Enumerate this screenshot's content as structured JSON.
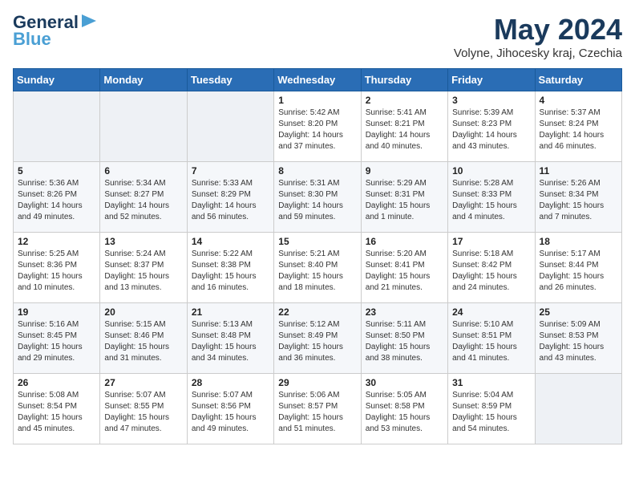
{
  "header": {
    "logo_line1": "General",
    "logo_line2": "Blue",
    "month_year": "May 2024",
    "location": "Volyne, Jihocesky kraj, Czechia"
  },
  "days_of_week": [
    "Sunday",
    "Monday",
    "Tuesday",
    "Wednesday",
    "Thursday",
    "Friday",
    "Saturday"
  ],
  "weeks": [
    [
      {
        "day": "",
        "info": ""
      },
      {
        "day": "",
        "info": ""
      },
      {
        "day": "",
        "info": ""
      },
      {
        "day": "1",
        "info": "Sunrise: 5:42 AM\nSunset: 8:20 PM\nDaylight: 14 hours\nand 37 minutes."
      },
      {
        "day": "2",
        "info": "Sunrise: 5:41 AM\nSunset: 8:21 PM\nDaylight: 14 hours\nand 40 minutes."
      },
      {
        "day": "3",
        "info": "Sunrise: 5:39 AM\nSunset: 8:23 PM\nDaylight: 14 hours\nand 43 minutes."
      },
      {
        "day": "4",
        "info": "Sunrise: 5:37 AM\nSunset: 8:24 PM\nDaylight: 14 hours\nand 46 minutes."
      }
    ],
    [
      {
        "day": "5",
        "info": "Sunrise: 5:36 AM\nSunset: 8:26 PM\nDaylight: 14 hours\nand 49 minutes."
      },
      {
        "day": "6",
        "info": "Sunrise: 5:34 AM\nSunset: 8:27 PM\nDaylight: 14 hours\nand 52 minutes."
      },
      {
        "day": "7",
        "info": "Sunrise: 5:33 AM\nSunset: 8:29 PM\nDaylight: 14 hours\nand 56 minutes."
      },
      {
        "day": "8",
        "info": "Sunrise: 5:31 AM\nSunset: 8:30 PM\nDaylight: 14 hours\nand 59 minutes."
      },
      {
        "day": "9",
        "info": "Sunrise: 5:29 AM\nSunset: 8:31 PM\nDaylight: 15 hours\nand 1 minute."
      },
      {
        "day": "10",
        "info": "Sunrise: 5:28 AM\nSunset: 8:33 PM\nDaylight: 15 hours\nand 4 minutes."
      },
      {
        "day": "11",
        "info": "Sunrise: 5:26 AM\nSunset: 8:34 PM\nDaylight: 15 hours\nand 7 minutes."
      }
    ],
    [
      {
        "day": "12",
        "info": "Sunrise: 5:25 AM\nSunset: 8:36 PM\nDaylight: 15 hours\nand 10 minutes."
      },
      {
        "day": "13",
        "info": "Sunrise: 5:24 AM\nSunset: 8:37 PM\nDaylight: 15 hours\nand 13 minutes."
      },
      {
        "day": "14",
        "info": "Sunrise: 5:22 AM\nSunset: 8:38 PM\nDaylight: 15 hours\nand 16 minutes."
      },
      {
        "day": "15",
        "info": "Sunrise: 5:21 AM\nSunset: 8:40 PM\nDaylight: 15 hours\nand 18 minutes."
      },
      {
        "day": "16",
        "info": "Sunrise: 5:20 AM\nSunset: 8:41 PM\nDaylight: 15 hours\nand 21 minutes."
      },
      {
        "day": "17",
        "info": "Sunrise: 5:18 AM\nSunset: 8:42 PM\nDaylight: 15 hours\nand 24 minutes."
      },
      {
        "day": "18",
        "info": "Sunrise: 5:17 AM\nSunset: 8:44 PM\nDaylight: 15 hours\nand 26 minutes."
      }
    ],
    [
      {
        "day": "19",
        "info": "Sunrise: 5:16 AM\nSunset: 8:45 PM\nDaylight: 15 hours\nand 29 minutes."
      },
      {
        "day": "20",
        "info": "Sunrise: 5:15 AM\nSunset: 8:46 PM\nDaylight: 15 hours\nand 31 minutes."
      },
      {
        "day": "21",
        "info": "Sunrise: 5:13 AM\nSunset: 8:48 PM\nDaylight: 15 hours\nand 34 minutes."
      },
      {
        "day": "22",
        "info": "Sunrise: 5:12 AM\nSunset: 8:49 PM\nDaylight: 15 hours\nand 36 minutes."
      },
      {
        "day": "23",
        "info": "Sunrise: 5:11 AM\nSunset: 8:50 PM\nDaylight: 15 hours\nand 38 minutes."
      },
      {
        "day": "24",
        "info": "Sunrise: 5:10 AM\nSunset: 8:51 PM\nDaylight: 15 hours\nand 41 minutes."
      },
      {
        "day": "25",
        "info": "Sunrise: 5:09 AM\nSunset: 8:53 PM\nDaylight: 15 hours\nand 43 minutes."
      }
    ],
    [
      {
        "day": "26",
        "info": "Sunrise: 5:08 AM\nSunset: 8:54 PM\nDaylight: 15 hours\nand 45 minutes."
      },
      {
        "day": "27",
        "info": "Sunrise: 5:07 AM\nSunset: 8:55 PM\nDaylight: 15 hours\nand 47 minutes."
      },
      {
        "day": "28",
        "info": "Sunrise: 5:07 AM\nSunset: 8:56 PM\nDaylight: 15 hours\nand 49 minutes."
      },
      {
        "day": "29",
        "info": "Sunrise: 5:06 AM\nSunset: 8:57 PM\nDaylight: 15 hours\nand 51 minutes."
      },
      {
        "day": "30",
        "info": "Sunrise: 5:05 AM\nSunset: 8:58 PM\nDaylight: 15 hours\nand 53 minutes."
      },
      {
        "day": "31",
        "info": "Sunrise: 5:04 AM\nSunset: 8:59 PM\nDaylight: 15 hours\nand 54 minutes."
      },
      {
        "day": "",
        "info": ""
      }
    ]
  ]
}
